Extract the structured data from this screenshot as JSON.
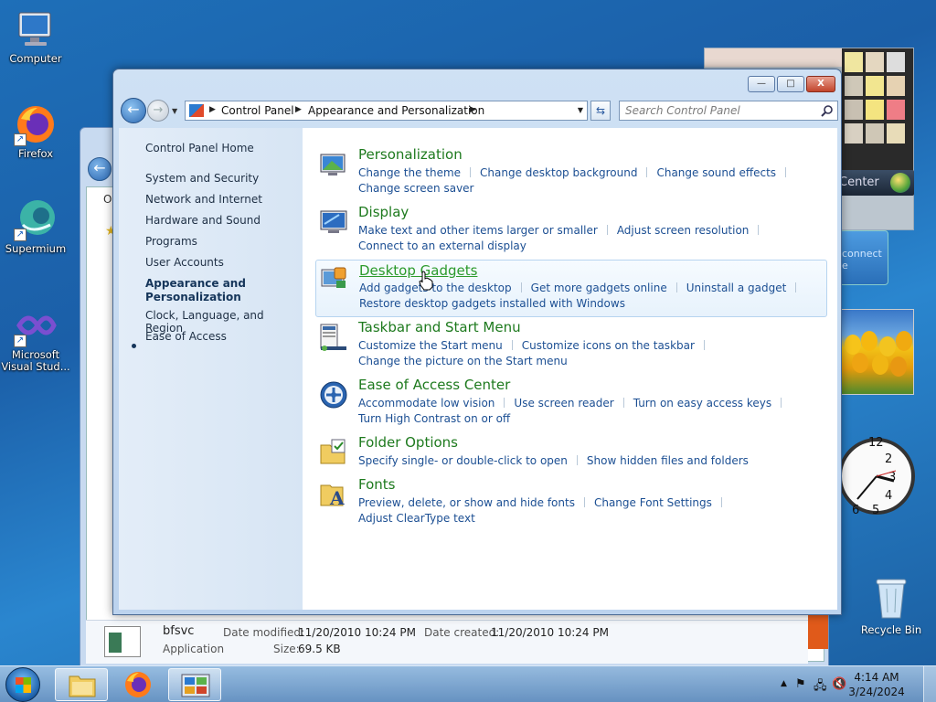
{
  "desktop": {
    "icons": [
      {
        "label": "Computer"
      },
      {
        "label": "Firefox"
      },
      {
        "label": "Supermium"
      },
      {
        "label": "Microsoft Visual Stud..."
      }
    ],
    "recycle_bin": "Recycle Bin",
    "media_center_label": "Center",
    "connect_gadget_label": "connect e"
  },
  "background_window": {
    "partial_letter": "O",
    "file": {
      "name": "bfsvc",
      "type": "Application",
      "date_modified_label": "Date modified:",
      "date_modified": "11/20/2010 10:24 PM",
      "date_created_label": "Date created:",
      "date_created": "11/20/2010 10:24 PM",
      "size_label": "Size:",
      "size": "69.5 KB"
    }
  },
  "window": {
    "buttons": {
      "minimize": "—",
      "maximize": "□",
      "close": "X"
    },
    "breadcrumb": [
      "Control Panel",
      "Appearance and Personalization"
    ],
    "search_placeholder": "Search Control Panel"
  },
  "sidebar": {
    "home": "Control Panel Home",
    "items": [
      {
        "label": "System and Security"
      },
      {
        "label": "Network and Internet"
      },
      {
        "label": "Hardware and Sound"
      },
      {
        "label": "Programs"
      },
      {
        "label": "User Accounts"
      },
      {
        "label": "Appearance and Personalization",
        "selected": true
      },
      {
        "label": "Clock, Language, and Region"
      },
      {
        "label": "Ease of Access"
      }
    ]
  },
  "categories": [
    {
      "title": "Personalization",
      "links": [
        "Change the theme",
        "Change desktop background",
        "Change sound effects",
        "Change screen saver"
      ]
    },
    {
      "title": "Display",
      "links": [
        "Make text and other items larger or smaller",
        "Adjust screen resolution",
        "Connect to an external display"
      ]
    },
    {
      "title": "Desktop Gadgets",
      "hover": true,
      "links": [
        "Add gadgets to the desktop",
        "Get more gadgets online",
        "Uninstall a gadget",
        "Restore desktop gadgets installed with Windows"
      ]
    },
    {
      "title": "Taskbar and Start Menu",
      "links": [
        "Customize the Start menu",
        "Customize icons on the taskbar",
        "Change the picture on the Start menu"
      ]
    },
    {
      "title": "Ease of Access Center",
      "links": [
        "Accommodate low vision",
        "Use screen reader",
        "Turn on easy access keys",
        "Turn High Contrast on or off"
      ]
    },
    {
      "title": "Folder Options",
      "links": [
        "Specify single- or double-click to open",
        "Show hidden files and folders"
      ]
    },
    {
      "title": "Fonts",
      "links": [
        "Preview, delete, or show and hide fonts",
        "Change Font Settings",
        "Adjust ClearType text"
      ]
    }
  ],
  "taskbar": {
    "pinned": [
      "windows-explorer",
      "firefox",
      "control-panel"
    ],
    "clock": {
      "time": "4:14 AM",
      "date": "3/24/2024"
    }
  },
  "colors": {
    "category_title": "#1e7a1e",
    "link": "#1c4f93",
    "sidebar_bg": "#dfe9f6"
  }
}
